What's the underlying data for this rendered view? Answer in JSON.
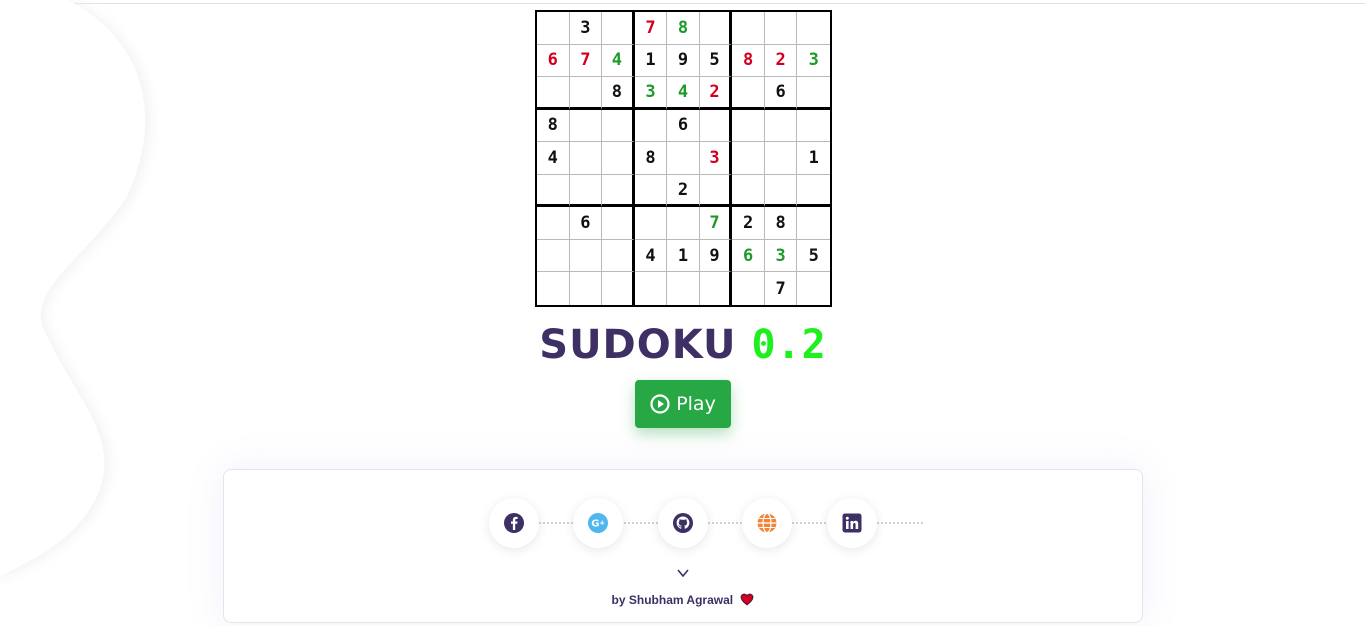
{
  "sudoku": {
    "rows": [
      [
        {
          "v": "",
          "c": "k"
        },
        {
          "v": "3",
          "c": "k"
        },
        {
          "v": "",
          "c": "k"
        },
        {
          "v": "7",
          "c": "r"
        },
        {
          "v": "8",
          "c": "g"
        },
        {
          "v": "",
          "c": "k"
        },
        {
          "v": "",
          "c": "k"
        },
        {
          "v": "",
          "c": "k"
        },
        {
          "v": "",
          "c": "k"
        }
      ],
      [
        {
          "v": "6",
          "c": "r"
        },
        {
          "v": "7",
          "c": "r"
        },
        {
          "v": "4",
          "c": "g"
        },
        {
          "v": "1",
          "c": "k"
        },
        {
          "v": "9",
          "c": "k"
        },
        {
          "v": "5",
          "c": "k"
        },
        {
          "v": "8",
          "c": "r"
        },
        {
          "v": "2",
          "c": "r"
        },
        {
          "v": "3",
          "c": "g"
        }
      ],
      [
        {
          "v": "",
          "c": "k"
        },
        {
          "v": "",
          "c": "k"
        },
        {
          "v": "8",
          "c": "k"
        },
        {
          "v": "3",
          "c": "g"
        },
        {
          "v": "4",
          "c": "g"
        },
        {
          "v": "2",
          "c": "r"
        },
        {
          "v": "",
          "c": "k"
        },
        {
          "v": "6",
          "c": "k"
        },
        {
          "v": "",
          "c": "k"
        }
      ],
      [
        {
          "v": "8",
          "c": "k"
        },
        {
          "v": "",
          "c": "k"
        },
        {
          "v": "",
          "c": "k"
        },
        {
          "v": "",
          "c": "k"
        },
        {
          "v": "6",
          "c": "k"
        },
        {
          "v": "",
          "c": "k"
        },
        {
          "v": "",
          "c": "k"
        },
        {
          "v": "",
          "c": "k"
        },
        {
          "v": "",
          "c": "k"
        }
      ],
      [
        {
          "v": "4",
          "c": "k"
        },
        {
          "v": "",
          "c": "k"
        },
        {
          "v": "",
          "c": "k"
        },
        {
          "v": "8",
          "c": "k"
        },
        {
          "v": "",
          "c": "k"
        },
        {
          "v": "3",
          "c": "r"
        },
        {
          "v": "",
          "c": "k"
        },
        {
          "v": "",
          "c": "k"
        },
        {
          "v": "1",
          "c": "k"
        }
      ],
      [
        {
          "v": "",
          "c": "k"
        },
        {
          "v": "",
          "c": "k"
        },
        {
          "v": "",
          "c": "k"
        },
        {
          "v": "",
          "c": "k"
        },
        {
          "v": "2",
          "c": "k"
        },
        {
          "v": "",
          "c": "k"
        },
        {
          "v": "",
          "c": "k"
        },
        {
          "v": "",
          "c": "k"
        },
        {
          "v": "",
          "c": "k"
        }
      ],
      [
        {
          "v": "",
          "c": "k"
        },
        {
          "v": "6",
          "c": "k"
        },
        {
          "v": "",
          "c": "k"
        },
        {
          "v": "",
          "c": "k"
        },
        {
          "v": "",
          "c": "k"
        },
        {
          "v": "7",
          "c": "g"
        },
        {
          "v": "2",
          "c": "k"
        },
        {
          "v": "8",
          "c": "k"
        },
        {
          "v": "",
          "c": "k"
        }
      ],
      [
        {
          "v": "",
          "c": "k"
        },
        {
          "v": "",
          "c": "k"
        },
        {
          "v": "",
          "c": "k"
        },
        {
          "v": "4",
          "c": "k"
        },
        {
          "v": "1",
          "c": "k"
        },
        {
          "v": "9",
          "c": "k"
        },
        {
          "v": "6",
          "c": "g"
        },
        {
          "v": "3",
          "c": "g"
        },
        {
          "v": "5",
          "c": "k"
        }
      ],
      [
        {
          "v": "",
          "c": "k"
        },
        {
          "v": "",
          "c": "k"
        },
        {
          "v": "",
          "c": "k"
        },
        {
          "v": "",
          "c": "k"
        },
        {
          "v": "",
          "c": "k"
        },
        {
          "v": "",
          "c": "k"
        },
        {
          "v": "",
          "c": "k"
        },
        {
          "v": "7",
          "c": "k"
        },
        {
          "v": "",
          "c": "k"
        }
      ]
    ],
    "colors": {
      "k": "#111111",
      "r": "#d10020",
      "g": "#1c9a2a"
    }
  },
  "title": {
    "main": "SUDOKU",
    "version": "0.2",
    "main_color": "#3e2f64",
    "version_color": "#1ef01e"
  },
  "play_button": {
    "label": "Play",
    "icon": "play-circle-icon",
    "color": "#28a745"
  },
  "social_links": [
    {
      "name": "facebook",
      "icon": "facebook-icon",
      "color": "#3e2f64"
    },
    {
      "name": "google-plus",
      "icon": "google-plus-icon",
      "color": "#4fb7f0"
    },
    {
      "name": "github",
      "icon": "github-icon",
      "color": "#3e2f64"
    },
    {
      "name": "website",
      "icon": "globe-icon",
      "color": "#f0853a"
    },
    {
      "name": "linkedin",
      "icon": "linkedin-icon",
      "color": "#3e2f64"
    }
  ],
  "footer": {
    "chevron": "chevron-down-icon",
    "byline": "by Shubham Agrawal",
    "heart_icon": "heart-icon",
    "heart_color": "#d10020"
  }
}
